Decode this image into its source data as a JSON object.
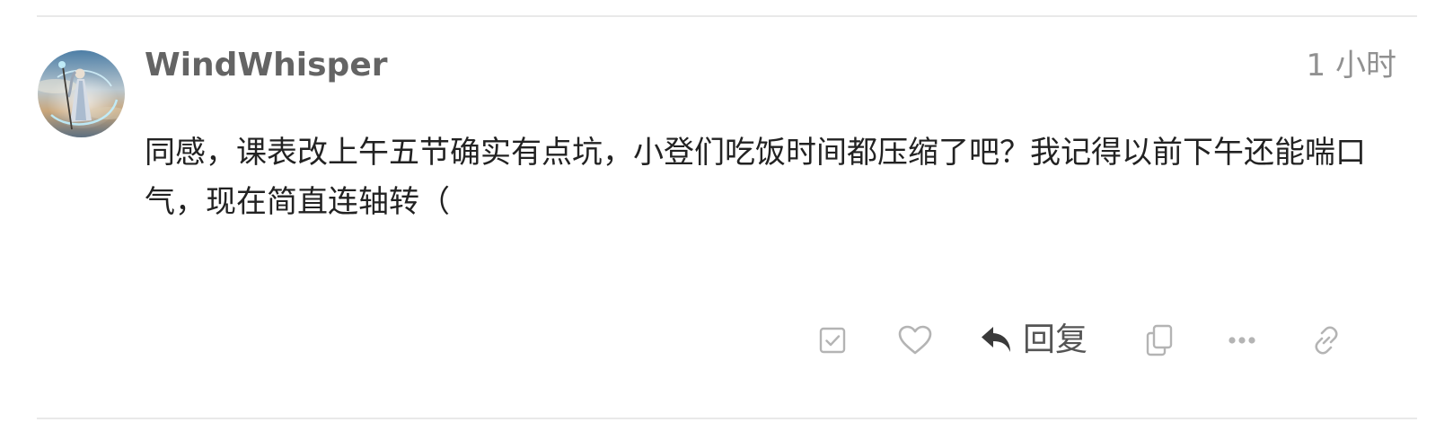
{
  "post": {
    "author": "WindWhisper",
    "time": "1 小时",
    "body": "同感，课表改上午五节确实有点坑，小登们吃饭时间都压缩了吧？我记得以前下午还能喘口气，现在简直连轴转（",
    "avatar_icon": "avatar-sorceress-illustration"
  },
  "actions": {
    "bookmark_icon": "checkbox-icon",
    "like_icon": "heart-icon",
    "reply_icon": "reply-arrow-icon",
    "reply_label": "回复",
    "copy_icon": "copy-icon",
    "more_icon": "ellipsis-icon",
    "link_icon": "link-icon"
  },
  "colors": {
    "divider": "#e9e9e9",
    "author": "#646464",
    "time": "#919191",
    "body": "#222222",
    "icon": "#b4b4b4",
    "reply": "#555555"
  }
}
